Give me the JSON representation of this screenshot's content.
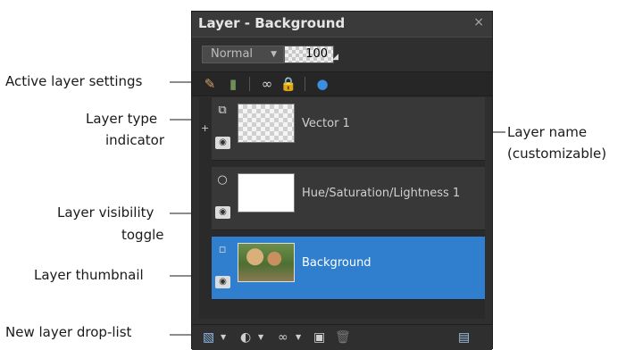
{
  "panel": {
    "title": "Layer - Background",
    "close_glyph": "×",
    "blend_mode": "Normal",
    "dropdown_arrow": "▼",
    "opacity": "100",
    "layers": [
      {
        "name": "Vector 1",
        "type": "vector",
        "expander": "+"
      },
      {
        "name": "Hue/Saturation/Lightness 1",
        "type": "adjustment"
      },
      {
        "name": "Background",
        "type": "raster",
        "selected": true
      }
    ],
    "toolbar_icons": [
      "edit-layer-icon",
      "mask-icon",
      "link-icon",
      "lock-icon",
      "effects-icon"
    ],
    "bottom_icons": [
      "new-layer-icon",
      "new-adjustment-layer-icon",
      "new-mask-icon",
      "merge-icon",
      "delete-icon",
      "properties-icon"
    ]
  },
  "callouts": {
    "active_layer_settings": "Active layer settings",
    "layer_type_indicator_1": "Layer type",
    "layer_type_indicator_2": "indicator",
    "layer_visibility_1": "Layer visibility",
    "layer_visibility_2": "toggle",
    "layer_thumbnail": "Layer thumbnail",
    "new_layer_droplist": "New layer drop-list",
    "layer_name_1": "Layer name",
    "layer_name_2": "(customizable)"
  },
  "colors": {
    "selected_row": "#2f7fce",
    "panel_bg": "#2f2f2f",
    "callout_line": "#8c8c8c"
  }
}
